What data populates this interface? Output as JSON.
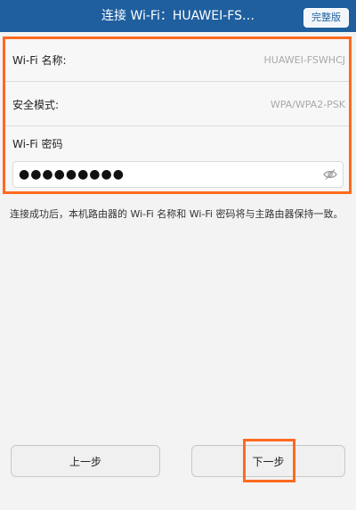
{
  "header": {
    "title": "连接 Wi-Fi：HUAWEI-FS…",
    "full_version_label": "完整版"
  },
  "settings": {
    "ssid_label": "Wi-Fi 名称:",
    "ssid_value": "HUAWEI-FSWHCJ",
    "security_label": "安全模式:",
    "security_value": "WPA/WPA2-PSK",
    "password_label": "Wi-Fi 密码",
    "password_value": "●●●●●●●●●"
  },
  "info_text": "连接成功后，本机路由器的 Wi-Fi 名称和 Wi-Fi 密码将与主路由器保持一致。",
  "buttons": {
    "prev_label": "上一步",
    "next_label": "下一步"
  },
  "colors": {
    "header_bg": "#1f5f9e",
    "highlight": "#ff6a1f"
  },
  "icons": {
    "password_toggle": "eye-icon"
  }
}
